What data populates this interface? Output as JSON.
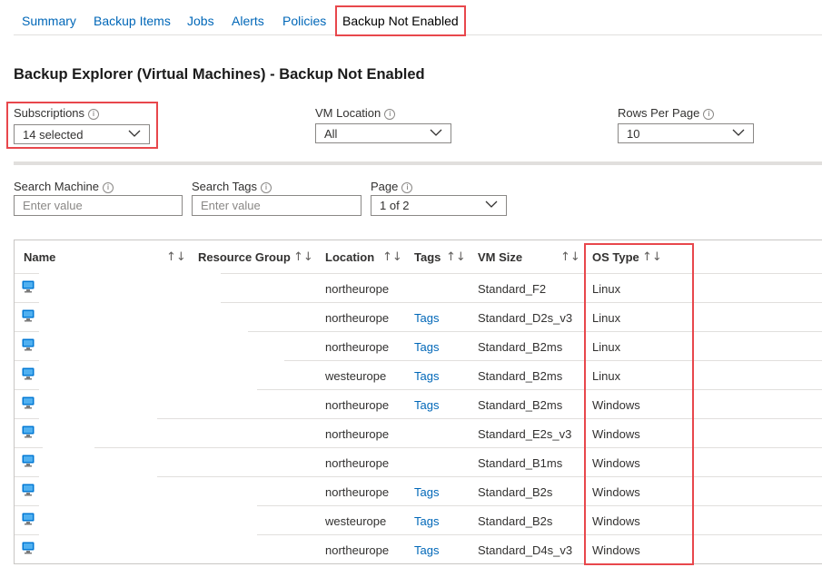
{
  "tabs": [
    {
      "label": "Summary"
    },
    {
      "label": "Backup Items"
    },
    {
      "label": "Jobs"
    },
    {
      "label": "Alerts"
    },
    {
      "label": "Policies"
    },
    {
      "label": "Backup Not Enabled"
    }
  ],
  "page_title": "Backup Explorer (Virtual Machines) - Backup Not Enabled",
  "filters": {
    "subscriptions": {
      "label": "Subscriptions",
      "value": "14 selected"
    },
    "vm_location": {
      "label": "VM Location",
      "value": "All"
    },
    "rows_per_page": {
      "label": "Rows Per Page",
      "value": "10"
    },
    "search_machine": {
      "label": "Search Machine",
      "placeholder": "Enter value",
      "value": ""
    },
    "search_tags": {
      "label": "Search Tags",
      "placeholder": "Enter value",
      "value": ""
    },
    "page": {
      "label": "Page",
      "value": "1 of 2"
    }
  },
  "info_glyph": "i",
  "sort_glyph": "↑↓",
  "table": {
    "columns": [
      "Name",
      "Resource Group",
      "Location",
      "Tags",
      "VM Size",
      "OS Type"
    ],
    "rows": [
      {
        "location": "northeurope",
        "tags": "",
        "vm_size": "Standard_F2",
        "os_type": "Linux"
      },
      {
        "location": "northeurope",
        "tags": "Tags",
        "vm_size": "Standard_D2s_v3",
        "os_type": "Linux"
      },
      {
        "location": "northeurope",
        "tags": "Tags",
        "vm_size": "Standard_B2ms",
        "os_type": "Linux"
      },
      {
        "location": "westeurope",
        "tags": "Tags",
        "vm_size": "Standard_B2ms",
        "os_type": "Linux"
      },
      {
        "location": "northeurope",
        "tags": "Tags",
        "vm_size": "Standard_B2ms",
        "os_type": "Windows"
      },
      {
        "location": "northeurope",
        "tags": "",
        "vm_size": "Standard_E2s_v3",
        "os_type": "Windows"
      },
      {
        "location": "northeurope",
        "tags": "",
        "vm_size": "Standard_B1ms",
        "os_type": "Windows"
      },
      {
        "location": "northeurope",
        "tags": "Tags",
        "vm_size": "Standard_B2s",
        "os_type": "Windows"
      },
      {
        "location": "westeurope",
        "tags": "Tags",
        "vm_size": "Standard_B2s",
        "os_type": "Windows"
      },
      {
        "location": "northeurope",
        "tags": "Tags",
        "vm_size": "Standard_D4s_v3",
        "os_type": "Windows"
      }
    ]
  },
  "colors": {
    "link": "#0067b8",
    "highlight_box": "#e8474c",
    "vm_icon": "#0078d4"
  }
}
